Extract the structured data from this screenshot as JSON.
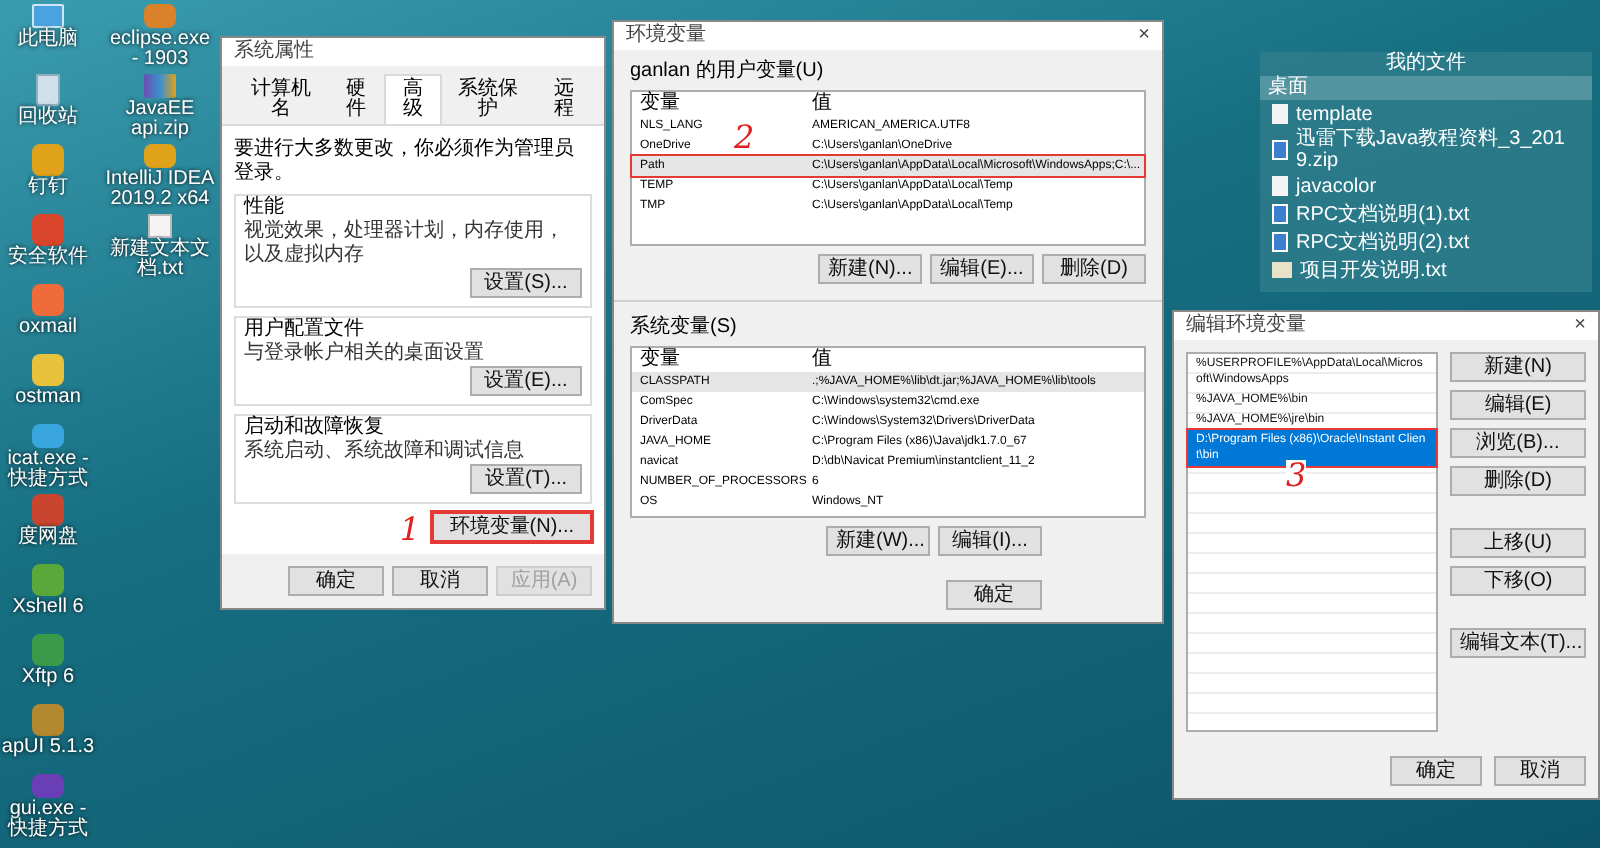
{
  "desktop_column_1": [
    {
      "label": "此电脑",
      "kind": "computer"
    },
    {
      "label": "回收站",
      "kind": "bin"
    },
    {
      "label": "钉钉",
      "kind": "app"
    },
    {
      "label": "安全软件",
      "kind": "app"
    },
    {
      "label": "oxmail",
      "kind": "app"
    },
    {
      "label": "ostman",
      "kind": "app"
    },
    {
      "label": "icat.exe - 快捷方式",
      "kind": "app"
    },
    {
      "label": "度网盘",
      "kind": "app"
    },
    {
      "label": "Xshell 6",
      "kind": "app"
    },
    {
      "label": "Xftp 6",
      "kind": "app"
    },
    {
      "label": "apUI 5.1.3",
      "kind": "app"
    },
    {
      "label": "gui.exe - 快捷方式",
      "kind": "app"
    }
  ],
  "desktop_column_2": [
    {
      "label": "eclipse.exe - 1903",
      "kind": "app"
    },
    {
      "label": "JavaEE api.zip",
      "kind": "archive"
    },
    {
      "label": "IntelliJ IDEA 2019.2 x64",
      "kind": "app"
    },
    {
      "label": "新建文本文档.txt",
      "kind": "file"
    }
  ],
  "fence": {
    "title": "我的文件",
    "group": "桌面",
    "items": [
      {
        "label": "template",
        "kind": "file"
      },
      {
        "label": "迅雷下载Java教程资料_3_2019.zip",
        "kind": "doc"
      },
      {
        "label": "javacolor",
        "kind": "file"
      },
      {
        "label": "RPC文档说明(1).txt",
        "kind": "doc"
      },
      {
        "label": "RPC文档说明(2).txt",
        "kind": "doc"
      },
      {
        "label": "项目开发说明.txt",
        "kind": "folder"
      }
    ]
  },
  "system_properties": {
    "title": "系统属性",
    "tabs": [
      {
        "label": "计算机名",
        "selected": false
      },
      {
        "label": "硬件",
        "selected": false
      },
      {
        "label": "高级",
        "selected": true
      },
      {
        "label": "系统保护",
        "selected": false
      },
      {
        "label": "远程",
        "selected": false
      }
    ],
    "notice": "要进行大多数更改，你必须作为管理员登录。",
    "groups": [
      {
        "title": "性能",
        "text": "视觉效果，处理器计划，内存使用，以及虚拟内存",
        "button": "设置(S)..."
      },
      {
        "title": "用户配置文件",
        "text": "与登录帐户相关的桌面设置",
        "button": "设置(E)..."
      },
      {
        "title": "启动和故障恢复",
        "text": "系统启动、系统故障和调试信息",
        "button": "设置(T)..."
      }
    ],
    "env_button": {
      "label": "环境变量(N)...",
      "marked": true
    },
    "annotation": "1",
    "footer": [
      {
        "label": "确定",
        "disabled": false
      },
      {
        "label": "取消",
        "disabled": false
      },
      {
        "label": "应用(A)",
        "disabled": true
      }
    ]
  },
  "environment_variables": {
    "title": "环境变量",
    "close": "×",
    "user_section": {
      "label": "ganlan 的用户变量(U)",
      "columns": [
        "变量",
        "值"
      ],
      "rows": [
        {
          "name": "NLS_LANG",
          "value": "AMERICAN_AMERICA.UTF8",
          "selected": false,
          "marked": false
        },
        {
          "name": "OneDrive",
          "value": "C:\\Users\\ganlan\\OneDrive",
          "selected": false,
          "marked": false
        },
        {
          "name": "Path",
          "value": "C:\\Users\\ganlan\\AppData\\Local\\Microsoft\\WindowsApps;C:\\...",
          "selected": true,
          "marked": true
        },
        {
          "name": "TEMP",
          "value": "C:\\Users\\ganlan\\AppData\\Local\\Temp",
          "selected": false,
          "marked": false
        },
        {
          "name": "TMP",
          "value": "C:\\Users\\ganlan\\AppData\\Local\\Temp",
          "selected": false,
          "marked": false
        }
      ],
      "buttons": [
        "新建(N)...",
        "编辑(E)...",
        "删除(D)"
      ]
    },
    "annotation": "2",
    "system_section": {
      "label": "系统变量(S)",
      "columns": [
        "变量",
        "值"
      ],
      "rows": [
        {
          "name": "CLASSPATH",
          "value": ".;%JAVA_HOME%\\lib\\dt.jar;%JAVA_HOME%\\lib\\tools",
          "selected": true,
          "marked": false
        },
        {
          "name": "ComSpec",
          "value": "C:\\Windows\\system32\\cmd.exe",
          "selected": false,
          "marked": false
        },
        {
          "name": "DriverData",
          "value": "C:\\Windows\\System32\\Drivers\\DriverData",
          "selected": false,
          "marked": false
        },
        {
          "name": "JAVA_HOME",
          "value": "C:\\Program Files (x86)\\Java\\jdk1.7.0_67",
          "selected": false,
          "marked": false
        },
        {
          "name": "navicat",
          "value": "D:\\db\\Navicat Premium\\instantclient_11_2",
          "selected": false,
          "marked": false
        },
        {
          "name": "NUMBER_OF_PROCESSORS",
          "value": "6",
          "selected": false,
          "marked": false
        },
        {
          "name": "OS",
          "value": "Windows_NT",
          "selected": false,
          "marked": false
        }
      ],
      "buttons": [
        "新建(W)...",
        "编辑(I)..."
      ]
    },
    "footer": [
      "确定"
    ]
  },
  "edit_variable": {
    "title": "编辑环境变量",
    "close": "×",
    "entries": [
      {
        "text": "%USERPROFILE%\\AppData\\Local\\Microsoft\\WindowsApps",
        "selected": false,
        "marked": false
      },
      {
        "text": "%JAVA_HOME%\\bin",
        "selected": false,
        "marked": false
      },
      {
        "text": "%JAVA_HOME%\\jre\\bin",
        "selected": false,
        "marked": false
      },
      {
        "text": "D:\\Program Files (x86)\\Oracle\\Instant Client\\bin",
        "selected": true,
        "marked": true
      }
    ],
    "annotation": "3",
    "button_groups": [
      [
        "新建(N)",
        "编辑(E)",
        "浏览(B)...",
        "删除(D)"
      ],
      [
        "上移(U)",
        "下移(O)"
      ],
      [
        "编辑文本(T)..."
      ]
    ],
    "footer": [
      "确定",
      "取消"
    ]
  }
}
